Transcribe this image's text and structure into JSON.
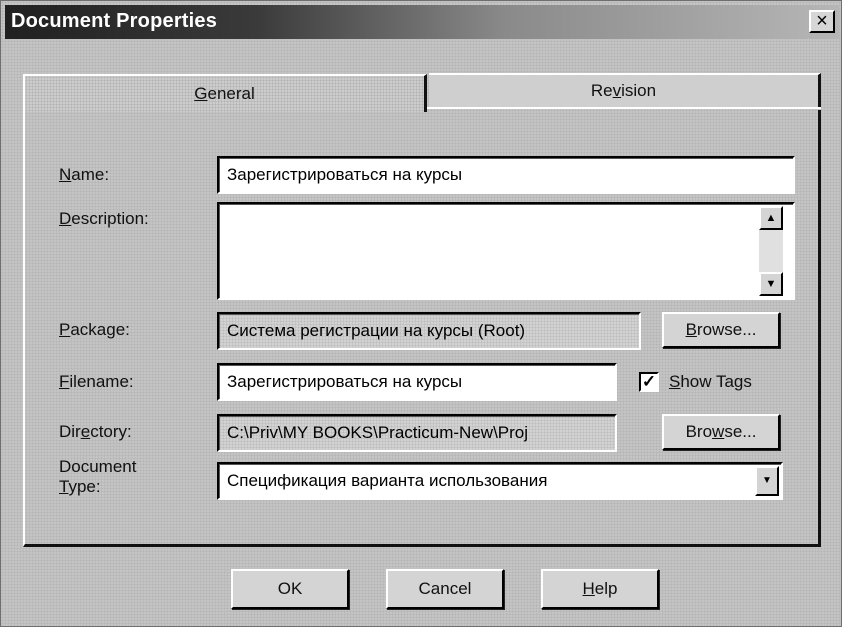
{
  "window": {
    "title": "Document Properties",
    "close_glyph": "×"
  },
  "tabs": [
    {
      "label_pre": "",
      "mnemonic": "G",
      "label_post": "eneral",
      "active": true
    },
    {
      "label_pre": "Re",
      "mnemonic": "v",
      "label_post": "ision",
      "active": false
    }
  ],
  "form": {
    "name": {
      "label_mn": "N",
      "label_rest": "ame:",
      "value": "Зарегистрироваться на курсы"
    },
    "description": {
      "label_mn": "D",
      "label_rest": "escription:",
      "value": ""
    },
    "package": {
      "label_mn": "P",
      "label_rest": "ackage:",
      "value": "Система регистрации на курсы (Root)"
    },
    "filename": {
      "label_mn": "F",
      "label_rest": "ilename:",
      "value": "Зарегистрироваться на курсы"
    },
    "directory": {
      "label_pre": "Dir",
      "label_mn": "e",
      "label_rest": "ctory:",
      "value": "C:\\Priv\\MY BOOKS\\Practicum-New\\Proj"
    },
    "document_type": {
      "label_line1": "Document",
      "label_mn": "T",
      "label_rest": "ype:",
      "value": "Спецификация варианта использования"
    },
    "browse_package": {
      "mn": "B",
      "rest": "rowse..."
    },
    "browse_directory": {
      "pre": "Bro",
      "mn": "w",
      "rest": "se..."
    },
    "show_tags": {
      "mn": "S",
      "rest": "how Tags",
      "checked": true,
      "check_glyph": "✓"
    }
  },
  "buttons": {
    "ok": "OK",
    "cancel": "Cancel",
    "help_mn": "H",
    "help_rest": "elp"
  },
  "icons": {
    "scroll_up": "▲",
    "scroll_down": "▼",
    "dropdown": "▼"
  }
}
